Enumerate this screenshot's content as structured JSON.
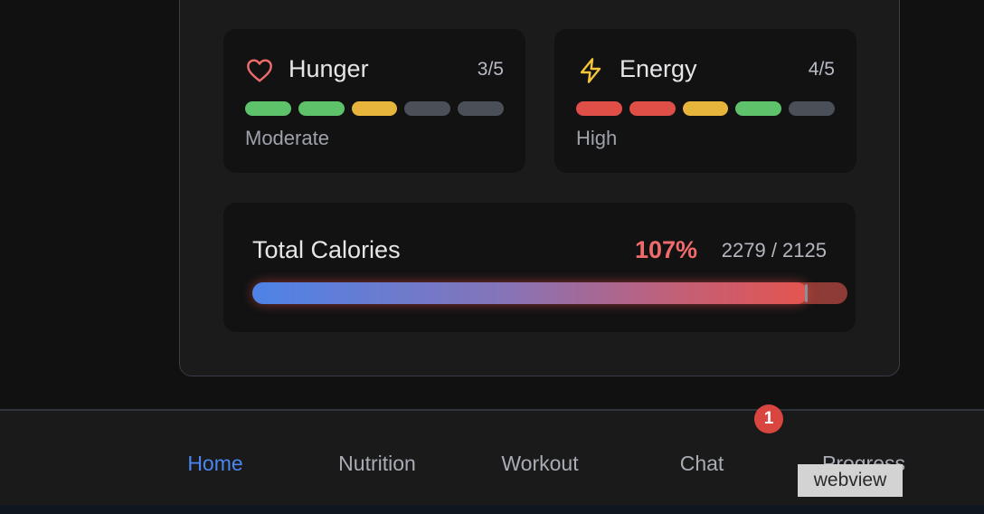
{
  "metrics": [
    {
      "name": "hunger",
      "label": "Hunger",
      "score": "3/5",
      "level": "Moderate",
      "icon": "heart-icon",
      "icon_color": "#ef6c6c",
      "segments": [
        "#5dc26a",
        "#5dc26a",
        "#e7b43c",
        "#4b4f58",
        "#4b4f58"
      ]
    },
    {
      "name": "energy",
      "label": "Energy",
      "score": "4/5",
      "level": "High",
      "icon": "lightning-icon",
      "icon_color": "#f3c53a",
      "segments": [
        "#e04e48",
        "#e04e48",
        "#e7b43c",
        "#5dc26a",
        "#4b4f58"
      ]
    }
  ],
  "calories": {
    "title": "Total Calories",
    "percent": "107%",
    "ratio": "2279 / 2125",
    "consumed": 2279,
    "goal": 2125,
    "percent_color": "#f06b6b"
  },
  "nav": {
    "items": [
      {
        "label": "Home",
        "active": true
      },
      {
        "label": "Nutrition",
        "active": false
      },
      {
        "label": "Workout",
        "active": false
      },
      {
        "label": "Chat",
        "active": false
      },
      {
        "label": "Progress",
        "active": false
      }
    ],
    "active_color": "#4a86f0",
    "badge": "1"
  },
  "overlay": {
    "webview_label": "webview"
  }
}
